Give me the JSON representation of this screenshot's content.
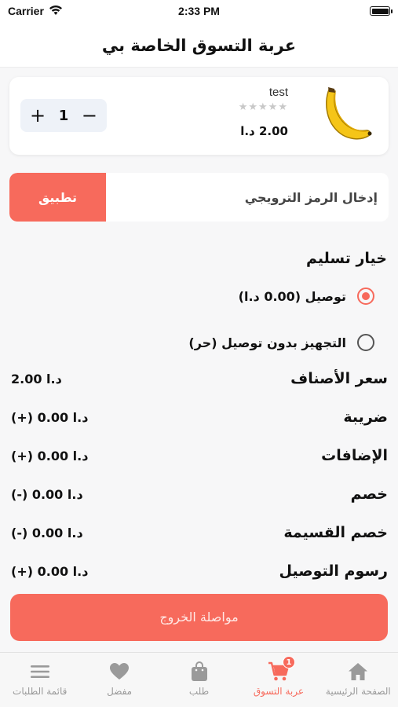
{
  "status_bar": {
    "carrier": "Carrier",
    "time": "2:33 PM"
  },
  "header": {
    "title": "عربة التسوق الخاصة بي"
  },
  "cart_item": {
    "name": "test",
    "rating": 0,
    "rating_stars": "★★★★★",
    "price": "2.00 د.ا",
    "quantity": "1",
    "minus": "−",
    "plus": "+"
  },
  "promo": {
    "placeholder": "إدخال الرمز الترويجي",
    "apply_label": "تطبيق"
  },
  "delivery": {
    "title": "خيار تسليم",
    "options": [
      {
        "label": "توصيل (0.00 د.ا)",
        "selected": true
      },
      {
        "label": "التجهيز بدون توصيل (حر)",
        "selected": false
      }
    ]
  },
  "summary": [
    {
      "label": "سعر الأصناف",
      "value": "2.00 د.ا"
    },
    {
      "label": "ضريبة",
      "value": "(+) 0.00 د.ا"
    },
    {
      "label": "الإضافات",
      "value": "(+) 0.00 د.ا"
    },
    {
      "label": "خصم",
      "value": "(-) 0.00 د.ا"
    },
    {
      "label": "خصم القسيمة",
      "value": "(-) 0.00 د.ا"
    },
    {
      "label": "رسوم التوصيل",
      "value": "(+) 0.00 د.ا"
    }
  ],
  "checkout": {
    "label": "مواصلة الخروج"
  },
  "tabbar": {
    "items": [
      {
        "label": "قائمة الطلبات",
        "icon": "menu-icon",
        "active": false
      },
      {
        "label": "مفضل",
        "icon": "heart-icon",
        "active": false
      },
      {
        "label": "طلب",
        "icon": "bag-icon",
        "active": false
      },
      {
        "label": "عربة التسوق",
        "icon": "cart-icon",
        "active": true,
        "badge": "1"
      },
      {
        "label": "الصفحة الرئيسية",
        "icon": "home-icon",
        "active": false
      }
    ]
  },
  "colors": {
    "accent": "#f76a5c",
    "inactive": "#9a9a9a"
  }
}
